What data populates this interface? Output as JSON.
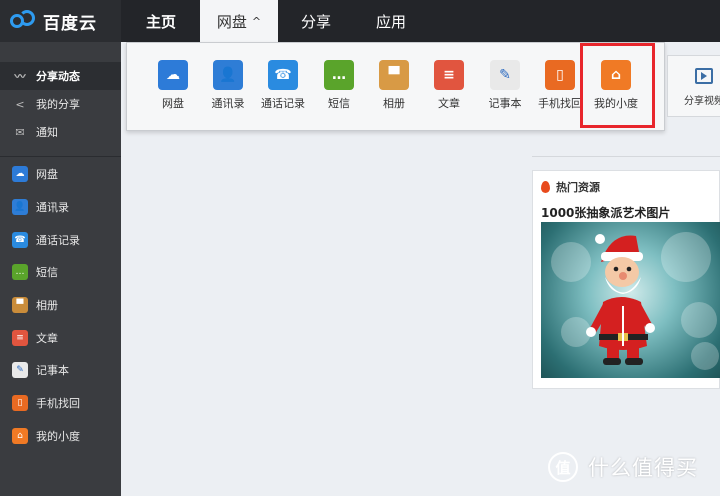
{
  "header": {
    "logo_text": "百度云",
    "nav": [
      {
        "label": "主页"
      },
      {
        "label": "网盘",
        "chevron": "^"
      },
      {
        "label": "分享"
      },
      {
        "label": "应用"
      }
    ]
  },
  "sidebar": {
    "items": [
      {
        "label": "分享动态",
        "icon": "trend-icon"
      },
      {
        "label": "我的分享",
        "icon": "share-icon"
      },
      {
        "label": "通知",
        "icon": "mail-icon"
      },
      {
        "label": "网盘",
        "icon": "cloud-icon",
        "color": "#2d7bd8"
      },
      {
        "label": "通讯录",
        "icon": "contacts-icon",
        "color": "#2e7dd6"
      },
      {
        "label": "通话记录",
        "icon": "call-log-icon",
        "color": "#2a8be0"
      },
      {
        "label": "短信",
        "icon": "sms-icon",
        "color": "#5aa42b"
      },
      {
        "label": "相册",
        "icon": "album-icon",
        "color": "#c98c3a"
      },
      {
        "label": "文章",
        "icon": "article-icon",
        "color": "#e1553f"
      },
      {
        "label": "记事本",
        "icon": "notepad-icon",
        "color": "#e9e9e9"
      },
      {
        "label": "手机找回",
        "icon": "phone-find-icon",
        "color": "#e96a22"
      },
      {
        "label": "我的小度",
        "icon": "home-icon",
        "color": "#f07a25"
      }
    ]
  },
  "dropdown": {
    "apps": [
      {
        "label": "网盘",
        "icon": "cloud-icon",
        "color": "#2d7bd8"
      },
      {
        "label": "通讯录",
        "icon": "contacts-icon",
        "color": "#2e7dd6"
      },
      {
        "label": "通话记录",
        "icon": "call-log-icon",
        "color": "#2a8be0"
      },
      {
        "label": "短信",
        "icon": "sms-icon",
        "color": "#5aa42b"
      },
      {
        "label": "相册",
        "icon": "album-icon",
        "color": "#d89a45"
      },
      {
        "label": "文章",
        "icon": "article-icon",
        "color": "#e1553f"
      },
      {
        "label": "记事本",
        "icon": "notepad-icon",
        "color": "#e9e9e9"
      },
      {
        "label": "手机找回",
        "icon": "phone-find-icon",
        "color": "#e96a22"
      },
      {
        "label": "我的小度",
        "icon": "home-icon",
        "color": "#f07a25"
      }
    ],
    "highlighted": "我的小度",
    "highlight_color": "#e8262c"
  },
  "side_panel": {
    "label": "分享视频",
    "icon": "video-icon"
  },
  "hot_resources": {
    "heading": "热门资源",
    "title": "1000张抽象派艺术图片",
    "image": "santa-claus-image"
  },
  "watermark": {
    "symbol": "值",
    "text": "什么值得买"
  }
}
